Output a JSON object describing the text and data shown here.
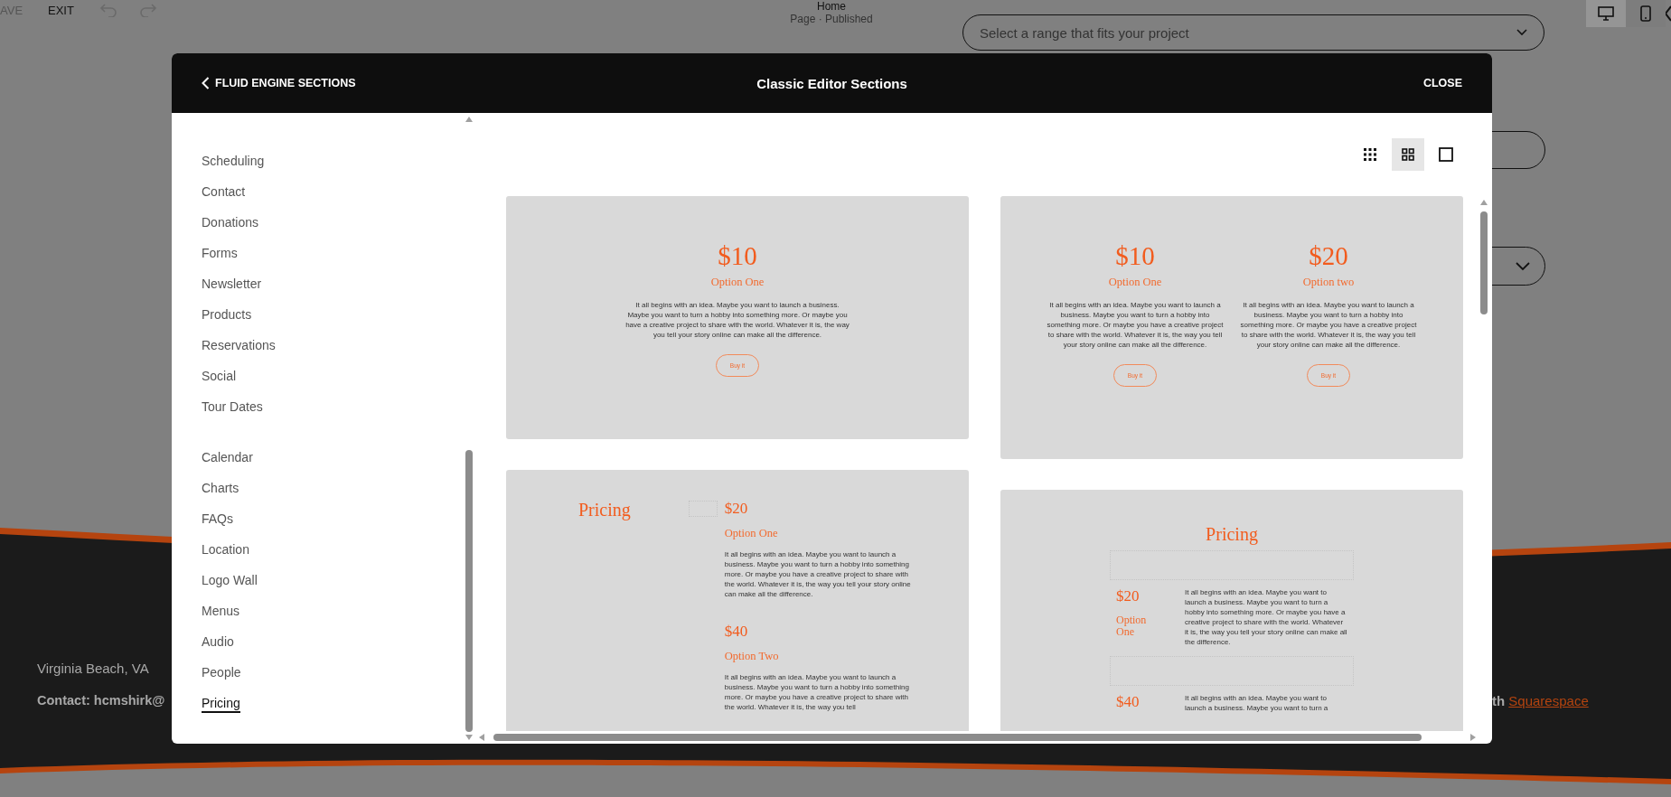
{
  "background_page": {
    "toolbar": {
      "save_label": "AVE",
      "exit_label": "EXIT",
      "page_title": "Home",
      "page_status": "Page · Published"
    },
    "form": {
      "select_placeholder": "Select a range that fits your project"
    },
    "footer": {
      "location": "Virginia Beach, VA",
      "contact": "Contact: hcmshirk@",
      "credit_prefix": "th",
      "credit_link": "Squarespace"
    }
  },
  "modal": {
    "back_label": "FLUID ENGINE SECTIONS",
    "title": "Classic Editor Sections",
    "close_label": "CLOSE"
  },
  "sidebar": {
    "groups": [
      {
        "items": [
          {
            "label": "Scheduling",
            "selected": false
          },
          {
            "label": "Contact",
            "selected": false
          },
          {
            "label": "Donations",
            "selected": false
          },
          {
            "label": "Forms",
            "selected": false
          },
          {
            "label": "Newsletter",
            "selected": false
          },
          {
            "label": "Products",
            "selected": false
          },
          {
            "label": "Reservations",
            "selected": false
          },
          {
            "label": "Social",
            "selected": false
          },
          {
            "label": "Tour Dates",
            "selected": false
          }
        ]
      },
      {
        "items": [
          {
            "label": "Calendar",
            "selected": false
          },
          {
            "label": "Charts",
            "selected": false
          },
          {
            "label": "FAQs",
            "selected": false
          },
          {
            "label": "Location",
            "selected": false
          },
          {
            "label": "Logo Wall",
            "selected": false
          },
          {
            "label": "Menus",
            "selected": false
          },
          {
            "label": "Audio",
            "selected": false
          },
          {
            "label": "People",
            "selected": false
          },
          {
            "label": "Pricing",
            "selected": true
          }
        ]
      }
    ]
  },
  "view_options": [
    {
      "kind": "small-grid",
      "selected": false
    },
    {
      "kind": "large-grid",
      "selected": true
    },
    {
      "kind": "single",
      "selected": false
    }
  ],
  "columns": [
    {
      "cards": [
        {
          "kind": "centered",
          "options": [
            {
              "price": "$10",
              "name": "Option One",
              "text": "It all begins with an idea. Maybe you want to launch a business. Maybe you want to turn a hobby into something more. Or maybe you have a creative project to share with the world. Whatever it is, the way you tell your story online can make all the difference.",
              "button": "Buy it"
            }
          ]
        },
        {
          "kind": "split",
          "title": "Pricing",
          "options": [
            {
              "price": "$20",
              "name": "Option One",
              "text": "It all begins with an idea. Maybe you want to launch a business. Maybe you want to turn a hobby into something more. Or maybe you have a creative project to share with the world. Whatever it is, the way you tell your story online can make all the difference."
            },
            {
              "price": "$40",
              "name": "Option Two",
              "text": "It all begins with an idea. Maybe you want to launch a business. Maybe you want to turn a hobby into something more. Or maybe you have a creative project to share with the world. Whatever it is, the way you tell"
            }
          ]
        }
      ]
    },
    {
      "cards": [
        {
          "kind": "centered",
          "options": [
            {
              "price": "$10",
              "name": "Option One",
              "text": "It all begins with an idea. Maybe you want to launch a business. Maybe you want to turn a hobby into something more. Or maybe you have a creative project to share with the world. Whatever it is, the way you tell your story online can make all the difference.",
              "button": "Buy it"
            },
            {
              "price": "$20",
              "name": "Option two",
              "text": "It all begins with an idea. Maybe you want to launch a business. Maybe you want to turn a hobby into something more. Or maybe you have a creative project to share with the world. Whatever it is, the way you tell your story online can make all the difference.",
              "button": "Buy it"
            }
          ]
        },
        {
          "kind": "table",
          "title": "Pricing",
          "options": [
            {
              "price": "$20",
              "name": "Option One",
              "text": "It all begins with an idea. Maybe you want to launch a business. Maybe you want to turn a hobby into something more. Or maybe you have a creative project to share with the world. Whatever it is, the way you tell your story online can make all the difference."
            },
            {
              "price": "$40",
              "text": "It all begins with an idea. Maybe you want to launch a business. Maybe you want to turn a"
            }
          ]
        }
      ]
    }
  ]
}
